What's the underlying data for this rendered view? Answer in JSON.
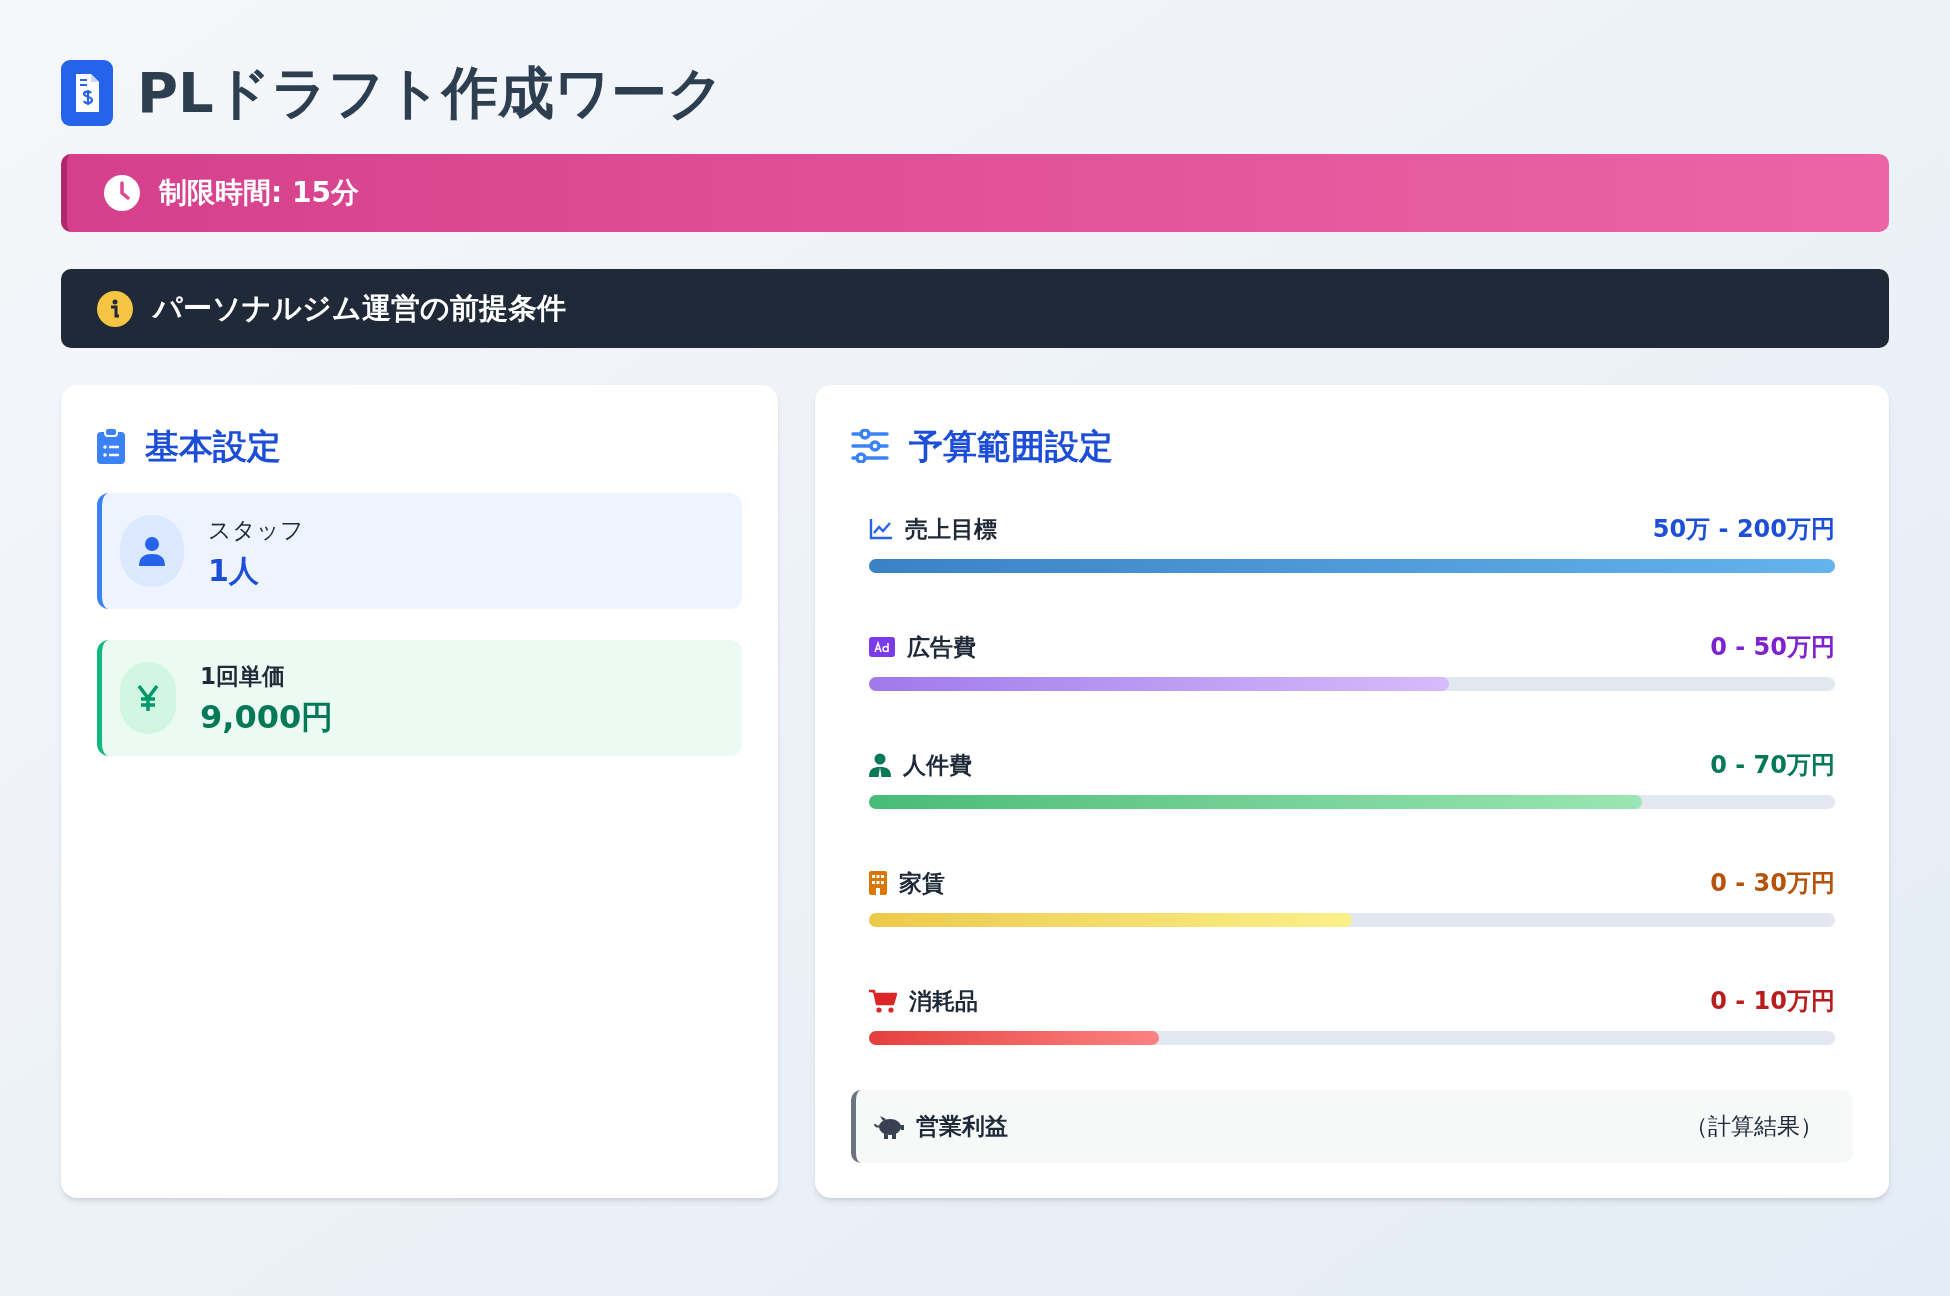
{
  "title": "PLドラフト作成ワーク",
  "time_limit": "制限時間: 15分",
  "premise": "パーソナルジム運営の前提条件",
  "basic": {
    "heading": "基本設定",
    "items": [
      {
        "kind": "staff",
        "label": "スタッフ",
        "value": "1人"
      },
      {
        "kind": "price",
        "label": "1回単価",
        "value": "9,000円"
      }
    ]
  },
  "budget": {
    "heading": "予算範囲設定",
    "ranges": [
      {
        "kind": "sales",
        "label": "売上目標",
        "range": "50万 - 200万円",
        "level": 1
      },
      {
        "kind": "ads",
        "label": "広告費",
        "range": "0 - 50万円",
        "level": 0.6
      },
      {
        "kind": "staff",
        "label": "人件費",
        "range": "0 - 70万円",
        "level": 0.8
      },
      {
        "kind": "rent",
        "label": "家賃",
        "range": "0 - 30万円",
        "level": 0.5
      },
      {
        "kind": "supplies",
        "label": "消耗品",
        "range": "0 - 10万円",
        "level": 0.3
      }
    ],
    "result": {
      "label": "営業利益",
      "value": "（計算結果）"
    }
  }
}
